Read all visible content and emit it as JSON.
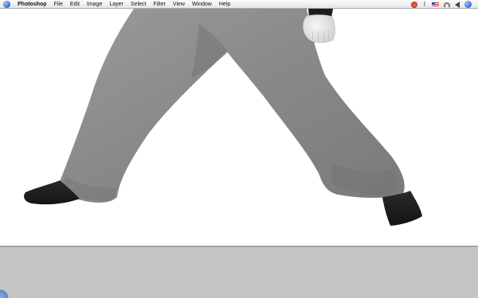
{
  "menubar": {
    "app_name": "Photoshop",
    "items": [
      "File",
      "Edit",
      "Image",
      "Layer",
      "Select",
      "Filter",
      "View",
      "Window",
      "Help"
    ],
    "bluetooth_symbol": "ᛒ",
    "menu_extras": [
      "bug-icon",
      "bluetooth-icon",
      "us-flag-icon",
      "wifi-icon",
      "volume-icon",
      "spotlight-icon"
    ]
  },
  "canvas": {
    "subject": "3D character lower body render",
    "colors": {
      "pants": "#8a8a8a",
      "shoes": "#1e1e1e",
      "hand": "#e8e8e8",
      "sleeve": "#1c1c1c"
    }
  },
  "panel_area": {
    "background": "#c4c4c4"
  }
}
